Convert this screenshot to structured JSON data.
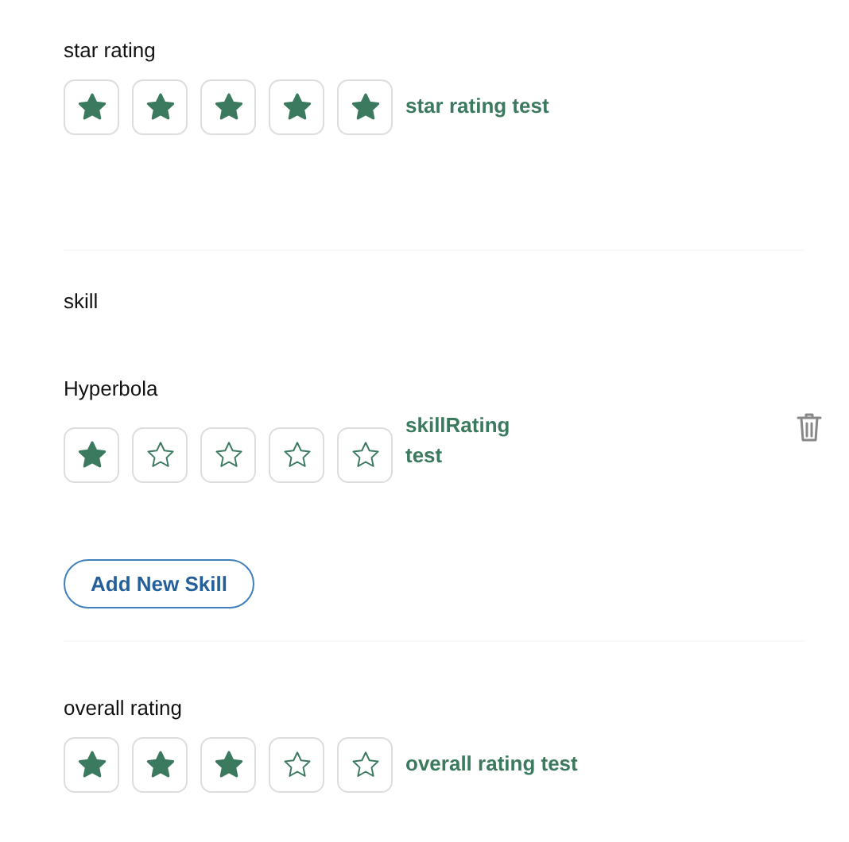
{
  "star_rating": {
    "label": "star rating",
    "stars": 5,
    "caption": "star rating test"
  },
  "skill": {
    "label": "skill",
    "items": [
      {
        "name": "Hyperbola",
        "stars": 1,
        "caption": "skillRating test"
      }
    ],
    "add_button": "Add New Skill"
  },
  "overall_rating": {
    "label": "overall rating",
    "stars": 3,
    "caption": "overall rating test"
  }
}
